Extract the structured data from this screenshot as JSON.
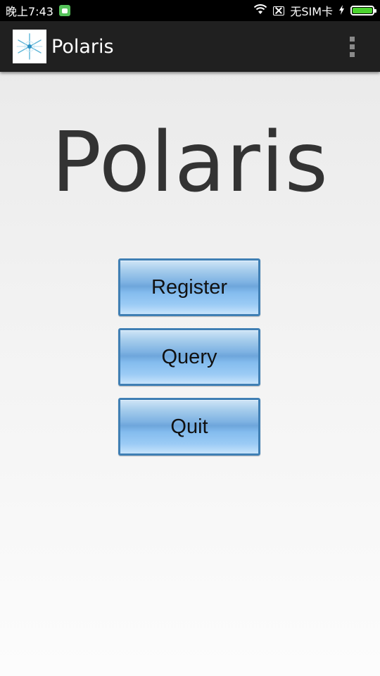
{
  "status_bar": {
    "time": "晚上7:43",
    "carrier": "无SIM卡",
    "icons": [
      "notification-icon",
      "wifi-icon",
      "no-sim-icon",
      "charging-icon",
      "battery-icon"
    ]
  },
  "action_bar": {
    "title": "Polaris",
    "logo_icon": "snowflake-logo-icon",
    "menu_icon": "overflow-menu-icon"
  },
  "main": {
    "heading": "Polaris",
    "buttons": [
      {
        "label": "Register"
      },
      {
        "label": "Query"
      },
      {
        "label": "Quit"
      }
    ]
  },
  "colors": {
    "status_bar": "#000000",
    "action_bar": "#202020",
    "button_border": "#3f7fb4",
    "button_fill": "#7fb3e3",
    "battery": "#4bd32e"
  }
}
